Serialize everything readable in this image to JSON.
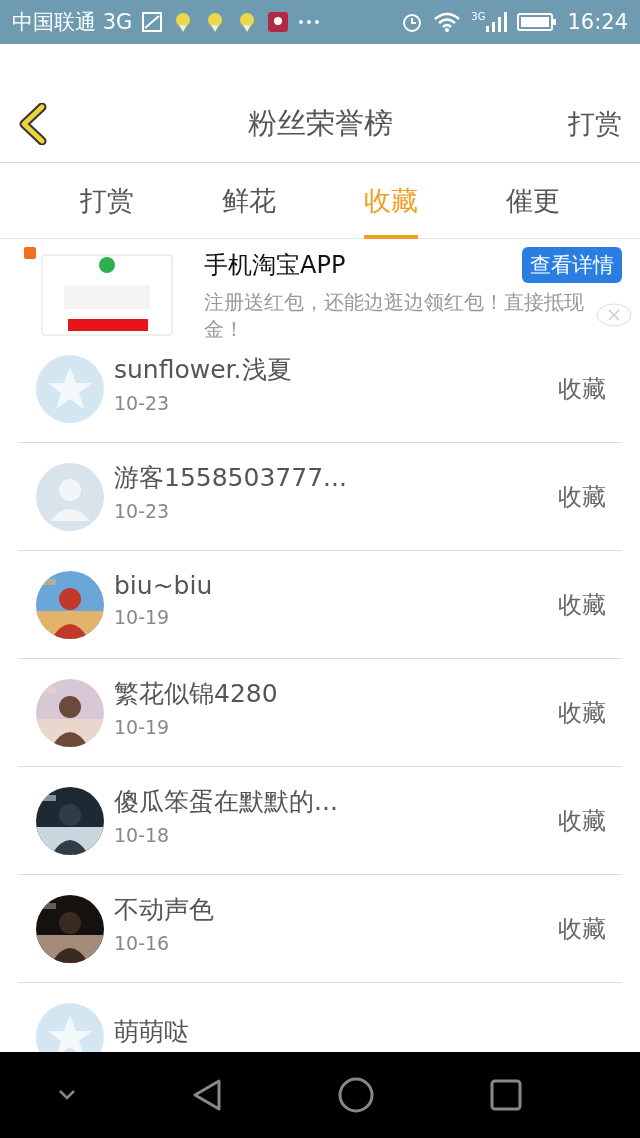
{
  "status_bar": {
    "carrier": "中国联通 3G",
    "time": "16:24",
    "network": "3G"
  },
  "header": {
    "title": "粉丝荣誉榜",
    "action": "打赏"
  },
  "tabs": [
    {
      "label": "打赏",
      "selected": false
    },
    {
      "label": "鲜花",
      "selected": false
    },
    {
      "label": "收藏",
      "selected": true
    },
    {
      "label": "催更",
      "selected": false
    }
  ],
  "ad": {
    "kind": "picture",
    "title": "手机淘宝APP",
    "button": "查看详情",
    "description": "注册送红包，还能边逛边领红包！直接抵现金！"
  },
  "fans": [
    {
      "kind": "star",
      "name": "sunflower.浅夏",
      "date": "10-23",
      "action": "收藏"
    },
    {
      "kind": "person",
      "name": "游客1558503777...",
      "date": "10-23",
      "action": "收藏"
    },
    {
      "kind": "picture",
      "name": "biu~biu",
      "date": "10-19",
      "action": "收藏"
    },
    {
      "kind": "picture",
      "name": "繁花似锦4280",
      "date": "10-19",
      "action": "收藏"
    },
    {
      "kind": "picture",
      "name": "傻瓜笨蛋在默默的...",
      "date": "10-18",
      "action": "收藏"
    },
    {
      "kind": "picture",
      "name": "不动声色",
      "date": "10-16",
      "action": "收藏"
    },
    {
      "kind": "star",
      "name": "萌萌哒"
    }
  ]
}
